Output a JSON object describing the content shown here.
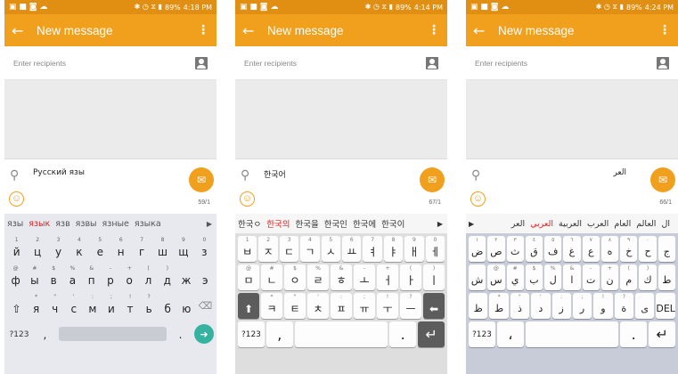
{
  "phones": [
    {
      "status": {
        "icons": "▣ ■ ◙ ☁",
        "right_icons": "✱ ◷ ⧖ ▮",
        "battery": "89%",
        "time": "4:18 PM"
      },
      "appbar": {
        "back": "←",
        "title": "New message",
        "more": "⋮"
      },
      "recipients": {
        "placeholder": "Enter recipients"
      },
      "compose": {
        "text": "Русский язы",
        "counter": "59/1",
        "clip": "⚲",
        "emoji": "☺",
        "send": "✉"
      },
      "suggestions": [
        "язы",
        "язык",
        "язв",
        "язвы",
        "язные",
        "языка"
      ],
      "suggestion_arrow": "▶",
      "rows": [
        {
          "hints": [
            "1",
            "2",
            "3",
            "4",
            "5",
            "6",
            "7",
            "8",
            "9",
            "0"
          ],
          "keys": [
            "й",
            "ц",
            "у",
            "к",
            "е",
            "н",
            "г",
            "ш",
            "щ",
            "з"
          ]
        },
        {
          "hints": [
            "@",
            "#",
            "$",
            "%",
            "&",
            "-",
            "+",
            "(",
            ")",
            "",
            ""
          ],
          "keys": [
            "ф",
            "ы",
            "в",
            "а",
            "п",
            "р",
            "о",
            "л",
            "д",
            "ж",
            "э"
          ]
        },
        {
          "hints": [
            "",
            "*",
            "\"",
            "'",
            ":",
            ";",
            "!",
            "?",
            "",
            ""
          ],
          "keys": [
            "⇧",
            "я",
            "ч",
            "с",
            "м",
            "и",
            "т",
            "ь",
            "б",
            "ю"
          ]
        }
      ],
      "bottom": {
        "n123": "?123",
        "comma": ",",
        "dot": ".",
        "enter": "➔"
      },
      "backspace": "⌫"
    },
    {
      "status": {
        "icons": "▣ ■ ◙ ☁",
        "right_icons": "✱ ◷ ⧖ ▮",
        "battery": "89%",
        "time": "4:14 PM"
      },
      "appbar": {
        "back": "←",
        "title": "New message",
        "more": "⋮"
      },
      "recipients": {
        "placeholder": "Enter recipients"
      },
      "compose": {
        "text": "한국어",
        "counter": "67/1",
        "clip": "⚲",
        "emoji": "☺",
        "send": "✉"
      },
      "suggestions": [
        "한국ㅇ",
        "한국의",
        "한국을",
        "한국인",
        "한국에",
        "한국이"
      ],
      "suggestion_arrow": "▶",
      "rows": [
        {
          "hints": [
            "1",
            "2",
            "3",
            "4",
            "5",
            "6",
            "7",
            "8",
            "9",
            "0"
          ],
          "keys": [
            "ㅂ",
            "ㅈ",
            "ㄷ",
            "ㄱ",
            "ㅅ",
            "ㅛ",
            "ㅕ",
            "ㅑ",
            "ㅐ",
            "ㅔ"
          ]
        },
        {
          "hints": [
            "@",
            "#",
            "$",
            "%",
            "&",
            "-",
            "+",
            "(",
            ")"
          ],
          "keys": [
            "ㅁ",
            "ㄴ",
            "ㅇ",
            "ㄹ",
            "ㅎ",
            "ㅗ",
            "ㅓ",
            "ㅏ",
            "ㅣ"
          ]
        },
        {
          "hints": [
            "",
            "*",
            "\"",
            "'",
            ":",
            ";",
            "!",
            "?",
            ""
          ],
          "keys": [
            "⬆",
            "ㅋ",
            "ㅌ",
            "ㅊ",
            "ㅍ",
            "ㅠ",
            "ㅜ",
            "ㅡ",
            "⬅"
          ]
        }
      ],
      "bottom": {
        "n123": "?123",
        "comma": ",",
        "dot": ".",
        "enter": "↵"
      }
    },
    {
      "status": {
        "icons": "▣ ■ ◙ ☁",
        "right_icons": "✱ ◷ ⧖ ▮",
        "battery": "89%",
        "time": "4:24 PM"
      },
      "appbar": {
        "back": "←",
        "title": "New message",
        "more": "⋮"
      },
      "recipients": {
        "placeholder": "Enter recipients"
      },
      "compose": {
        "text": "العر",
        "counter": "66/1",
        "clip": "⚲",
        "emoji": "☺",
        "send": "✉"
      },
      "suggestions": [
        "ال",
        "العالم",
        "العام",
        "العرب",
        "العربية",
        "العربي",
        "العر"
      ],
      "suggestion_arrow": "▶",
      "rows": [
        {
          "hints": [
            "١",
            "٢",
            "٣",
            "٤",
            "٥",
            "٦",
            "٧",
            "٨",
            "٩",
            "٠",
            ""
          ],
          "keys": [
            "ض",
            "ص",
            "ث",
            "ق",
            "ف",
            "غ",
            "ع",
            "ه",
            "خ",
            "ح",
            "ج"
          ]
        },
        {
          "hints": [
            "",
            "@",
            "#",
            "$",
            "%",
            "&",
            "-",
            "+",
            "(",
            ")",
            ""
          ],
          "keys": [
            "ش",
            "س",
            "ي",
            "ب",
            "ل",
            "ا",
            "ت",
            "ن",
            "م",
            "ك",
            "ط"
          ]
        },
        {
          "hints": [
            "",
            "*",
            "\"",
            "'",
            ":",
            ";",
            "!",
            "?",
            "",
            ""
          ],
          "keys": [
            "ظ",
            "ط",
            "ذ",
            "د",
            "ز",
            "ر",
            "و",
            "ة",
            "ى",
            "DEL"
          ]
        }
      ],
      "bottom": {
        "n123": "?123",
        "comma": "،",
        "dot": ".",
        "enter": "↵"
      }
    }
  ]
}
